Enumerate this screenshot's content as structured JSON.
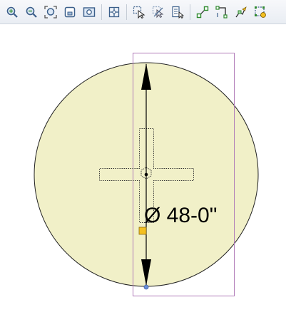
{
  "toolbar": {
    "buttons": [
      {
        "name": "zoom-in-icon"
      },
      {
        "name": "zoom-out-icon"
      },
      {
        "name": "zoom-extents-icon"
      },
      {
        "name": "zoom-window-icon"
      },
      {
        "name": "zoom-previous-icon"
      },
      {
        "name": "pan-icon"
      },
      {
        "name": "select-icon"
      },
      {
        "name": "deselect-icon"
      },
      {
        "name": "properties-icon"
      },
      {
        "name": "snap-endpoint-icon"
      },
      {
        "name": "snap-corner-icon"
      },
      {
        "name": "edit-vertex-icon"
      },
      {
        "name": "snap-settings-icon"
      }
    ]
  },
  "drawing": {
    "circle_fill": "#f1f0c8",
    "circle_stroke": "#222222",
    "selection_color": "#b07ab8",
    "grip_color": "#f4c020",
    "handle_color": "#6a8fd8",
    "dimension_label": "Ø 48-0\""
  }
}
